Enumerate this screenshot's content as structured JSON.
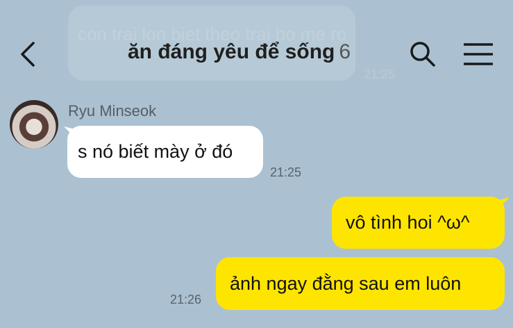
{
  "background_message": {
    "text": "con trai lon biet theo trai bo me ro",
    "time": "21:25"
  },
  "header": {
    "title": "ăn đáng yêu để sống",
    "member_count": "6"
  },
  "messages": [
    {
      "sender": "Ryu Minseok",
      "text": "s nó biết mày ở đó",
      "time": "21:25",
      "direction": "incoming"
    },
    {
      "text": "vô tình hoi ^ω^",
      "direction": "outgoing"
    },
    {
      "text": "ảnh ngay đằng sau em luôn",
      "time": "21:26",
      "direction": "outgoing"
    }
  ],
  "icons": [
    "back-arrow-icon",
    "search-icon",
    "menu-icon",
    "avatar"
  ],
  "colors": {
    "background": "#abc1d1",
    "outgoing_bubble": "#fee500",
    "incoming_bubble": "#ffffff"
  }
}
